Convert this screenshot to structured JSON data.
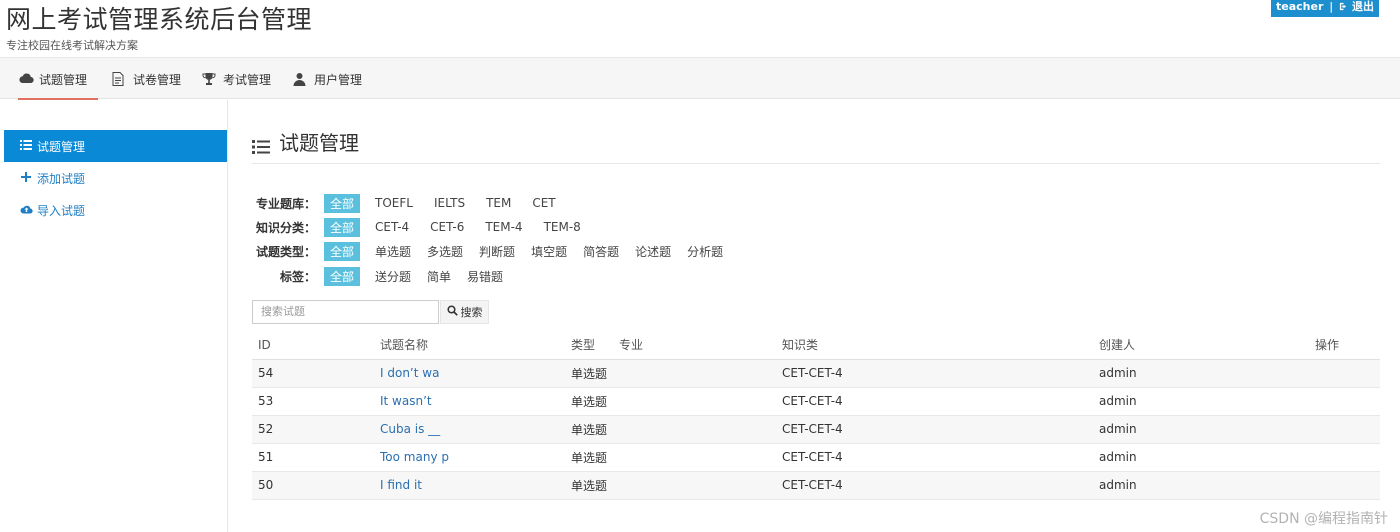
{
  "header": {
    "title": "网上考试管理系统后台管理",
    "subtitle": "专注校园在线考试解决方案",
    "user": "teacher",
    "separator": "|",
    "logout": "退出"
  },
  "topnav": [
    {
      "label": "试题管理",
      "icon": "cloud-icon",
      "active": true
    },
    {
      "label": "试卷管理",
      "icon": "document-icon",
      "active": false
    },
    {
      "label": "考试管理",
      "icon": "trophy-icon",
      "active": false
    },
    {
      "label": "用户管理",
      "icon": "user-icon",
      "active": false
    }
  ],
  "sidebar": [
    {
      "label": "试题管理",
      "icon": "list-icon",
      "active": true
    },
    {
      "label": "添加试题",
      "icon": "plus-icon",
      "active": false
    },
    {
      "label": "导入试题",
      "icon": "cloud-upload-icon",
      "active": false
    }
  ],
  "main": {
    "heading": "试题管理",
    "filters": [
      {
        "label": "专业题库：",
        "options": [
          "全部",
          "TOEFL",
          "IELTS",
          "TEM",
          "CET"
        ],
        "selected": "全部"
      },
      {
        "label": "知识分类：",
        "options": [
          "全部",
          "CET-4",
          "CET-6",
          "TEM-4",
          "TEM-8"
        ],
        "selected": "全部"
      },
      {
        "label": "试题类型：",
        "options": [
          "全部",
          "单选题",
          "多选题",
          "判断题",
          "填空题",
          "简答题",
          "论述题",
          "分析题"
        ],
        "selected": "全部"
      },
      {
        "label": "标签：",
        "options": [
          "全部",
          "送分题",
          "简单",
          "易错题"
        ],
        "selected": "全部"
      }
    ],
    "search": {
      "placeholder": "搜索试题",
      "button": "搜索"
    },
    "table": {
      "columns": [
        "ID",
        "试题名称",
        "类型",
        "专业",
        "知识类",
        "创建人",
        "操作"
      ],
      "rows": [
        {
          "id": "54",
          "name": "I don’t wa",
          "type": "单选题",
          "major": "",
          "knowledge": "CET-CET-4",
          "creator": "admin",
          "action": ""
        },
        {
          "id": "53",
          "name": "It wasn’t",
          "type": "单选题",
          "major": "",
          "knowledge": "CET-CET-4",
          "creator": "admin",
          "action": ""
        },
        {
          "id": "52",
          "name": "Cuba is __",
          "type": "单选题",
          "major": "",
          "knowledge": "CET-CET-4",
          "creator": "admin",
          "action": ""
        },
        {
          "id": "51",
          "name": "Too many p",
          "type": "单选题",
          "major": "",
          "knowledge": "CET-CET-4",
          "creator": "admin",
          "action": ""
        },
        {
          "id": "50",
          "name": "I find it",
          "type": "单选题",
          "major": "",
          "knowledge": "CET-CET-4",
          "creator": "admin",
          "action": ""
        }
      ]
    }
  },
  "watermark": "CSDN @编程指南针",
  "colors": {
    "accent": "#0a8ad6",
    "tag_active": "#5bc0de",
    "link": "#2a6fb0",
    "nav_underline": "#e07060"
  }
}
